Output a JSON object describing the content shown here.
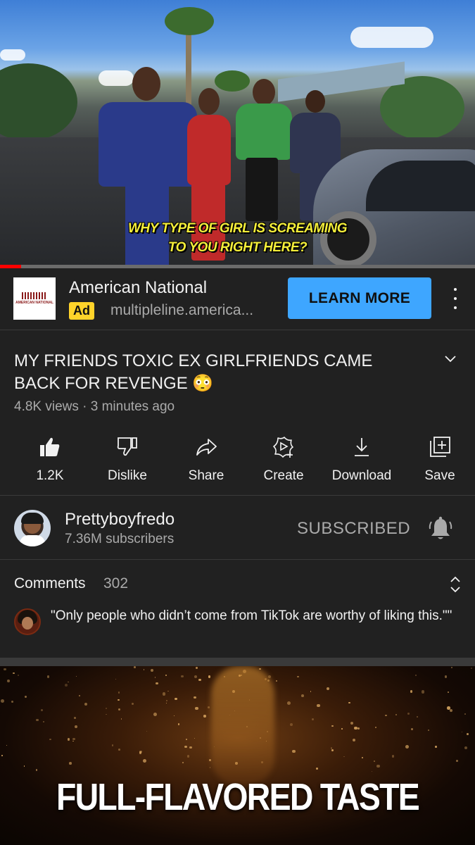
{
  "video": {
    "subtitle_line1": "WHY TYPE OF GIRL IS SCREAMING",
    "subtitle_line2": "TO YOU RIGHT HERE?",
    "progress_fraction": 0.045
  },
  "ad": {
    "logo_text": "AMERICAN NATIONAL",
    "title": "American National",
    "badge": "Ad",
    "url": "multipleline.america...",
    "cta": "LEARN MORE"
  },
  "title": "MY FRIENDS TOXIC EX GIRLFRIENDS CAME BACK FOR REVENGE 😳",
  "meta": "4.8K views · 3 minutes ago",
  "actions": [
    {
      "icon": "thumbs-up-icon",
      "label": "1.2K"
    },
    {
      "icon": "thumbs-down-icon",
      "label": "Dislike"
    },
    {
      "icon": "share-icon",
      "label": "Share"
    },
    {
      "icon": "create-icon",
      "label": "Create"
    },
    {
      "icon": "download-icon",
      "label": "Download"
    },
    {
      "icon": "save-icon",
      "label": "Save"
    }
  ],
  "channel": {
    "name": "Prettyboyfredo",
    "subscribers": "7.36M subscribers",
    "subscribe_state": "SUBSCRIBED",
    "bell_icon": "bell-icon"
  },
  "comments": {
    "label": "Comments",
    "count": "302",
    "top_comment": "\"Only people who didn’t come from TikTok are worthy of liking this.\"\""
  },
  "bottom_ad": {
    "text": "FULL-FLAVORED TASTE"
  },
  "colors": {
    "background": "#212121",
    "accent_blue": "#3ea6ff",
    "progress_red": "#ff0000",
    "ad_badge": "#ffd32a",
    "subtitle_yellow": "#f4ee3a"
  }
}
